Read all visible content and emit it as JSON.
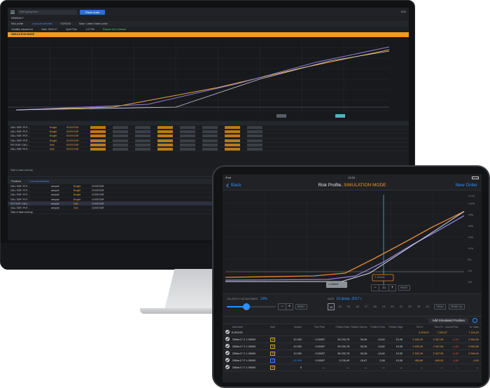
{
  "desktop": {
    "search_placeholder": "Start typing here...",
    "place_order": "Place order",
    "currency": "USD",
    "tab": "DEMOACT",
    "risk_profile_label": "Risk profile",
    "accounts_selected": "1 account selected",
    "pair": "EURUSD",
    "base_label": "Base: United States dollar",
    "vol_adj_label": "Volatility Adjustment",
    "date_label": "Date: 09/02/17",
    "spot_label": "Spot Price",
    "spot_value": "1.07750",
    "restore_label": "Restore All to Default",
    "sim_mode": "SIMULATION MODE",
    "table_rows": [
      {
        "inst": "CALL EUR / PUT ...",
        "side": "Bought",
        "amount": "50 000 EUR"
      },
      {
        "inst": "CALL EUR / PUT ...",
        "side": "Bought",
        "amount": "50 000 EUR"
      },
      {
        "inst": "CALL EUR / PUT ...",
        "side": "Bought",
        "amount": "50 000 EUR"
      },
      {
        "inst": "CALL EUR / PUT ...",
        "side": "Bought",
        "amount": "50 000 EUR"
      },
      {
        "inst": "PUT EUR / CALL ...",
        "side": "Sold",
        "amount": "50 000 EUR"
      },
      {
        "inst": "CALL EUR / PUT ...",
        "side": "Sold",
        "amount": "50 000 EUR"
      }
    ],
    "totals_label": "Total, in base currency",
    "positions_label": "Positions",
    "positions_accounts": "1 account selected",
    "position_rows": [
      {
        "inst": "CALL EUR / PUT ...",
        "acct": "avropa4",
        "side": "Bought",
        "amount": "10 000 EUR"
      },
      {
        "inst": "CALL EUR / PUT ...",
        "acct": "avropa4",
        "side": "Bought",
        "amount": "10 000 EUR"
      },
      {
        "inst": "CALL EUR / PUT ...",
        "acct": "avropa4",
        "side": "Bought",
        "amount": "10 000 EUR"
      },
      {
        "inst": "CALL EUR / PUT ...",
        "acct": "avropa4",
        "side": "Bought",
        "amount": "10 000 EUR"
      },
      {
        "inst": "PUT EUR / CALL ...",
        "acct": "avropa4",
        "side": "Sold",
        "amount": "10 000 EUR"
      },
      {
        "inst": "CALL EUR / PUT ...",
        "acct": "avropa4",
        "side": "Sold",
        "amount": "10 000 EUR"
      }
    ],
    "positions_total_label": "Total, in base currency"
  },
  "tablet": {
    "carrier": "iPad",
    "time": "13:34",
    "back": "Back",
    "title_prefix": "Risk Profile.",
    "title_mode": "SIMULATION MODE",
    "new_order": "New Order",
    "spot_marker": "1.08504",
    "cursor_value": "1.10128",
    "stepper_value": "10",
    "reset": "RESET",
    "vol_label": "VOLATILITY ADJUSTMENT",
    "vol_value": "19%",
    "date_label": "DATE",
    "date_value": "13 февр. 2017 г.",
    "days": [
      "13",
      "14",
      "15",
      "16",
      "17",
      "18",
      "19",
      "20",
      "21",
      "22",
      "23",
      "24"
    ],
    "today": "TODAY",
    "reset_all": "RESET ALL",
    "add_simulated": "Add Simulated Position",
    "columns": [
      "Instrument",
      "Side",
      "Amount",
      "Theo Price",
      "Position Delta",
      "Position Gamma",
      "Position Theta",
      "Position Vega",
      "Sim.%",
      "Theo P/L",
      "Current Price",
      "Ex. Value"
    ],
    "group": {
      "name": "EURUSD",
      "theo_pl": "3 005,57",
      "pl": "7 003,37",
      "ex": "7 116,20"
    },
    "rows": [
      {
        "inst": "25Mar17 C 1.05000",
        "side": "B",
        "amount": "10 000",
        "tp": "0.00097",
        "pd": "39 232,78",
        "pg": "53,36",
        "pt": "-13,82",
        "pv": "19,35",
        "tot": "2 632,39",
        "pl": "2 347,98",
        "cp": "-4,63",
        "ex": "2 564,00"
      },
      {
        "inst": "25Mar17 C 1.05000",
        "side": "B",
        "amount": "10 000",
        "tp": "0.00097",
        "pd": "39 232,78",
        "pg": "53,36",
        "pt": "-13,82",
        "pv": "19,35",
        "tot": "2 632,39",
        "pl": "2 347,98",
        "cp": "-4,63",
        "ex": "2 564,00"
      },
      {
        "inst": "25Mar17 C 1.05000",
        "side": "B",
        "amount": "10 000",
        "tp": "0.00097",
        "pd": "39 232,78",
        "pg": "53,36",
        "pt": "-13,82",
        "pv": "19,35",
        "tot": "2 632,39",
        "pl": "2 347,98",
        "cp": "-4,63",
        "ex": "2 564,00"
      },
      {
        "inst": "25Mar17 P 1.05000",
        "side": "S",
        "amount": "-10 000",
        "tp": "0.00097",
        "pd": "3 135,49",
        "pg": "-10,67",
        "pt": "2,56",
        "pv": "19,35",
        "tot": "450,80",
        "pl": "640,00",
        "cp": "4,86",
        "ex": "-0,00"
      },
      {
        "inst": "25Mar17 C 1.05000",
        "side": "B",
        "amount": "0",
        "tp": "—",
        "pd": "—",
        "pg": "—",
        "pt": "—",
        "pv": "—",
        "tot": "—",
        "pl": "—",
        "cp": "—",
        "ex": "—"
      }
    ]
  }
}
